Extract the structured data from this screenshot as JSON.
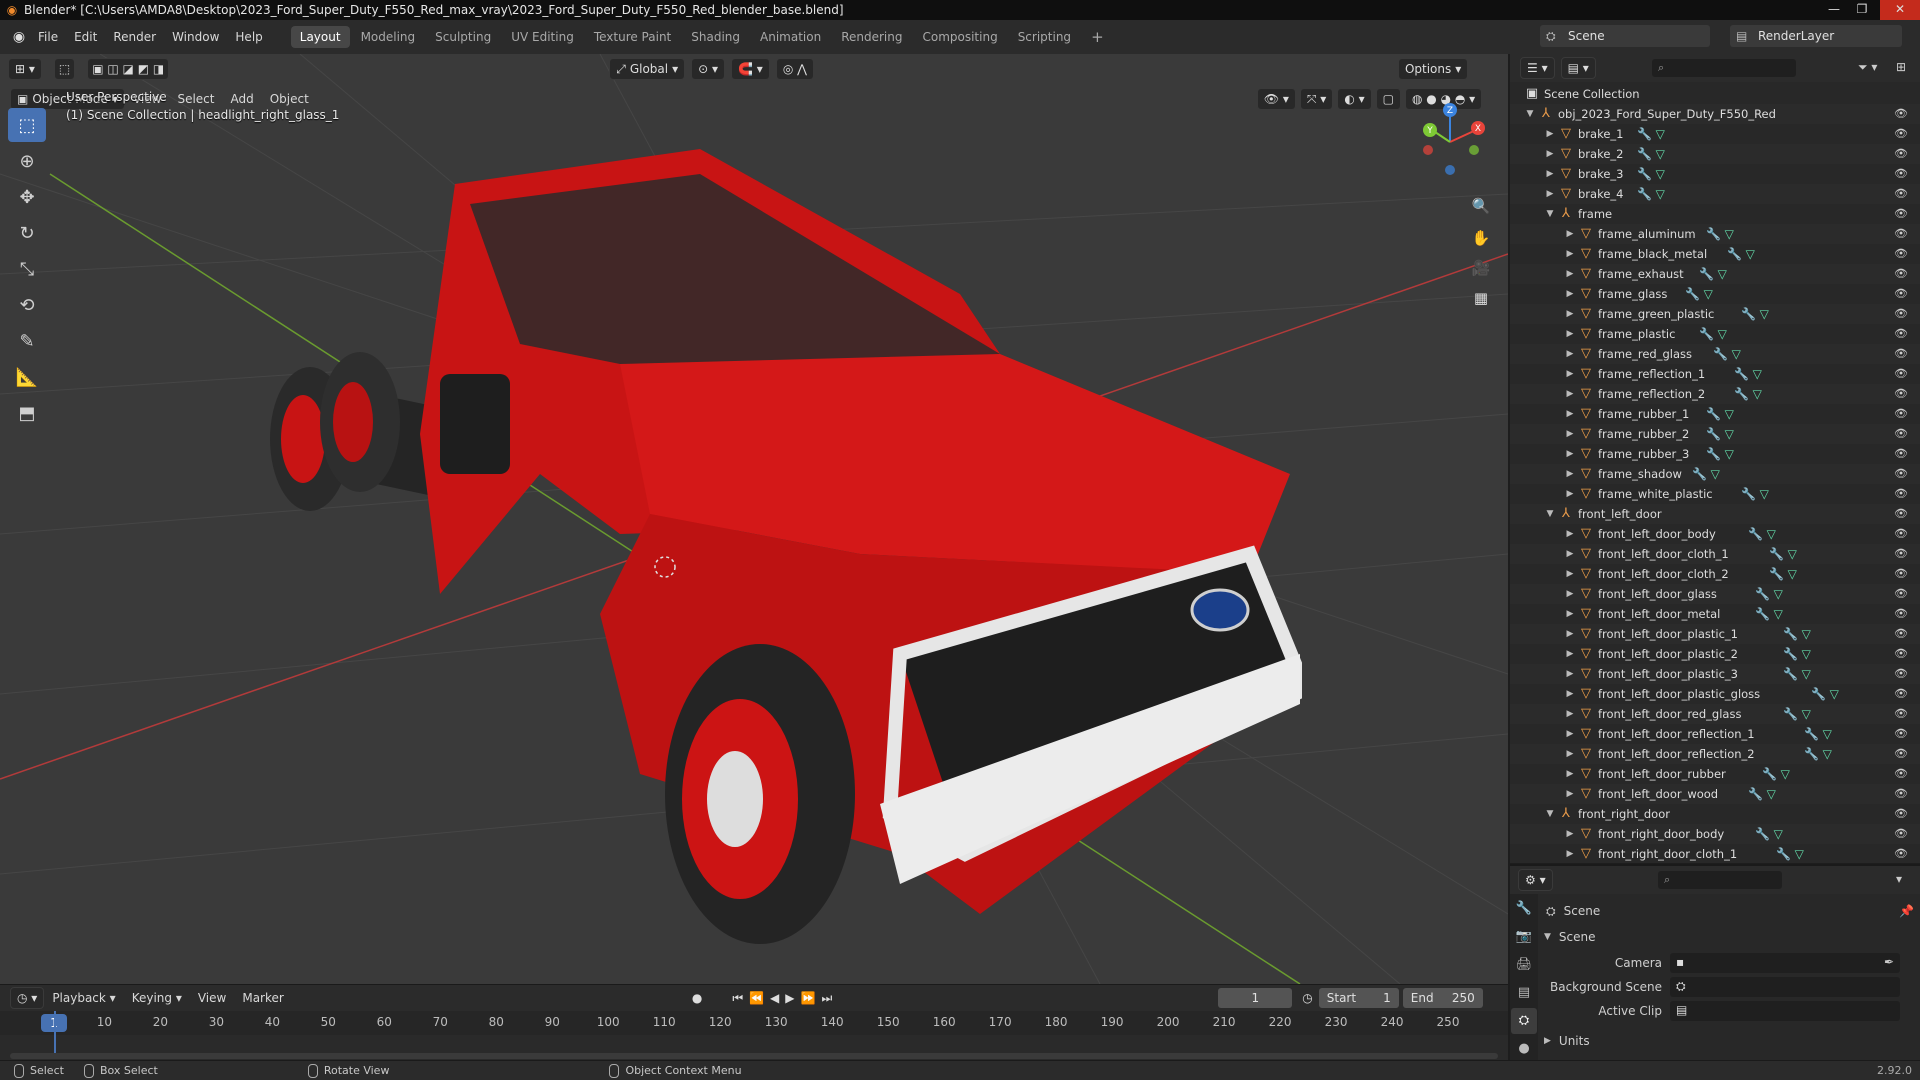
{
  "window": {
    "title": "Blender* [C:\\Users\\AMDA8\\Desktop\\2023_Ford_Super_Duty_F550_Red_max_vray\\2023_Ford_Super_Duty_F550_Red_blender_base.blend]"
  },
  "menubar": {
    "menus": [
      "File",
      "Edit",
      "Render",
      "Window",
      "Help"
    ],
    "workspaces": [
      "Layout",
      "Modeling",
      "Sculpting",
      "UV Editing",
      "Texture Paint",
      "Shading",
      "Animation",
      "Rendering",
      "Compositing",
      "Scripting"
    ],
    "active_workspace": "Layout",
    "add_tab": "+",
    "scene": "Scene",
    "view_layer": "RenderLayer"
  },
  "viewport": {
    "transform_orientation": "Global",
    "options_label": "Options",
    "mode": "Object Mode",
    "menus": [
      "View",
      "Select",
      "Add",
      "Object"
    ],
    "perspective_label": "User Perspective",
    "context_label": "(1) Scene Collection | headlight_right_glass_1",
    "gizmo_axes": {
      "x": "X",
      "y": "Y",
      "z": "Z"
    },
    "colors": {
      "x_axis": "#e8443a",
      "y_axis": "#7ec935",
      "z_axis": "#3b84e0",
      "truck_red": "#c81414",
      "grid_bg": "#3a3a3a"
    }
  },
  "toolbar": {
    "tools": [
      "select-box",
      "cursor",
      "move",
      "rotate",
      "scale",
      "transform",
      "annotate",
      "measure",
      "add-cube"
    ]
  },
  "outliner": {
    "root": "Scene Collection",
    "rows": [
      {
        "name": "obj_2023_Ford_Super_Duty_F550_Red",
        "level": 0,
        "type": "empty",
        "expanded": true,
        "mods": false
      },
      {
        "name": "brake_1",
        "level": 1,
        "type": "mesh",
        "expanded": false,
        "mods": true
      },
      {
        "name": "brake_2",
        "level": 1,
        "type": "mesh",
        "expanded": false,
        "mods": true
      },
      {
        "name": "brake_3",
        "level": 1,
        "type": "mesh",
        "expanded": false,
        "mods": true
      },
      {
        "name": "brake_4",
        "level": 1,
        "type": "mesh",
        "expanded": false,
        "mods": true
      },
      {
        "name": "frame",
        "level": 1,
        "type": "empty",
        "expanded": true,
        "mods": false
      },
      {
        "name": "frame_aluminum",
        "level": 2,
        "type": "mesh",
        "expanded": false,
        "mods": true
      },
      {
        "name": "frame_black_metal",
        "level": 2,
        "type": "mesh",
        "expanded": false,
        "mods": true
      },
      {
        "name": "frame_exhaust",
        "level": 2,
        "type": "mesh",
        "expanded": false,
        "mods": true
      },
      {
        "name": "frame_glass",
        "level": 2,
        "type": "mesh",
        "expanded": false,
        "mods": true
      },
      {
        "name": "frame_green_plastic",
        "level": 2,
        "type": "mesh",
        "expanded": false,
        "mods": true
      },
      {
        "name": "frame_plastic",
        "level": 2,
        "type": "mesh",
        "expanded": false,
        "mods": true
      },
      {
        "name": "frame_red_glass",
        "level": 2,
        "type": "mesh",
        "expanded": false,
        "mods": true
      },
      {
        "name": "frame_reflection_1",
        "level": 2,
        "type": "mesh",
        "expanded": false,
        "mods": true
      },
      {
        "name": "frame_reflection_2",
        "level": 2,
        "type": "mesh",
        "expanded": false,
        "mods": true
      },
      {
        "name": "frame_rubber_1",
        "level": 2,
        "type": "mesh",
        "expanded": false,
        "mods": true
      },
      {
        "name": "frame_rubber_2",
        "level": 2,
        "type": "mesh",
        "expanded": false,
        "mods": true
      },
      {
        "name": "frame_rubber_3",
        "level": 2,
        "type": "mesh",
        "expanded": false,
        "mods": true
      },
      {
        "name": "frame_shadow",
        "level": 2,
        "type": "mesh",
        "expanded": false,
        "mods": true
      },
      {
        "name": "frame_white_plastic",
        "level": 2,
        "type": "mesh",
        "expanded": false,
        "mods": true
      },
      {
        "name": "front_left_door",
        "level": 1,
        "type": "empty",
        "expanded": true,
        "mods": false
      },
      {
        "name": "front_left_door_body",
        "level": 2,
        "type": "mesh",
        "expanded": false,
        "mods": true
      },
      {
        "name": "front_left_door_cloth_1",
        "level": 2,
        "type": "mesh",
        "expanded": false,
        "mods": true
      },
      {
        "name": "front_left_door_cloth_2",
        "level": 2,
        "type": "mesh",
        "expanded": false,
        "mods": true
      },
      {
        "name": "front_left_door_glass",
        "level": 2,
        "type": "mesh",
        "expanded": false,
        "mods": true
      },
      {
        "name": "front_left_door_metal",
        "level": 2,
        "type": "mesh",
        "expanded": false,
        "mods": true
      },
      {
        "name": "front_left_door_plastic_1",
        "level": 2,
        "type": "mesh",
        "expanded": false,
        "mods": true
      },
      {
        "name": "front_left_door_plastic_2",
        "level": 2,
        "type": "mesh",
        "expanded": false,
        "mods": true
      },
      {
        "name": "front_left_door_plastic_3",
        "level": 2,
        "type": "mesh",
        "expanded": false,
        "mods": true
      },
      {
        "name": "front_left_door_plastic_gloss",
        "level": 2,
        "type": "mesh",
        "expanded": false,
        "mods": true
      },
      {
        "name": "front_left_door_red_glass",
        "level": 2,
        "type": "mesh",
        "expanded": false,
        "mods": true
      },
      {
        "name": "front_left_door_reflection_1",
        "level": 2,
        "type": "mesh",
        "expanded": false,
        "mods": true
      },
      {
        "name": "front_left_door_reflection_2",
        "level": 2,
        "type": "mesh",
        "expanded": false,
        "mods": true
      },
      {
        "name": "front_left_door_rubber",
        "level": 2,
        "type": "mesh",
        "expanded": false,
        "mods": true
      },
      {
        "name": "front_left_door_wood",
        "level": 2,
        "type": "mesh",
        "expanded": false,
        "mods": true
      },
      {
        "name": "front_right_door",
        "level": 1,
        "type": "empty",
        "expanded": true,
        "mods": false
      },
      {
        "name": "front_right_door_body",
        "level": 2,
        "type": "mesh",
        "expanded": false,
        "mods": true
      },
      {
        "name": "front_right_door_cloth_1",
        "level": 2,
        "type": "mesh",
        "expanded": false,
        "mods": true
      }
    ]
  },
  "properties": {
    "header_label": "Scene",
    "panel_title": "Scene",
    "fields": [
      {
        "label": "Camera",
        "value": ""
      },
      {
        "label": "Background Scene",
        "value": ""
      },
      {
        "label": "Active Clip",
        "value": ""
      }
    ],
    "units_label": "Units"
  },
  "timeline": {
    "menus": [
      "Playback",
      "Keying",
      "View",
      "Marker"
    ],
    "current_frame": "1",
    "start_label": "Start",
    "start": "1",
    "end_label": "End",
    "end": "250",
    "ticks": [
      "1",
      "10",
      "20",
      "30",
      "40",
      "50",
      "60",
      "70",
      "80",
      "90",
      "100",
      "110",
      "120",
      "130",
      "140",
      "150",
      "160",
      "170",
      "180",
      "190",
      "200",
      "210",
      "220",
      "230",
      "240",
      "250"
    ]
  },
  "statusbar": {
    "select": "Select",
    "box_select": "Box Select",
    "rotate_view": "Rotate View",
    "context_menu": "Object Context Menu",
    "version": "2.92.0"
  }
}
